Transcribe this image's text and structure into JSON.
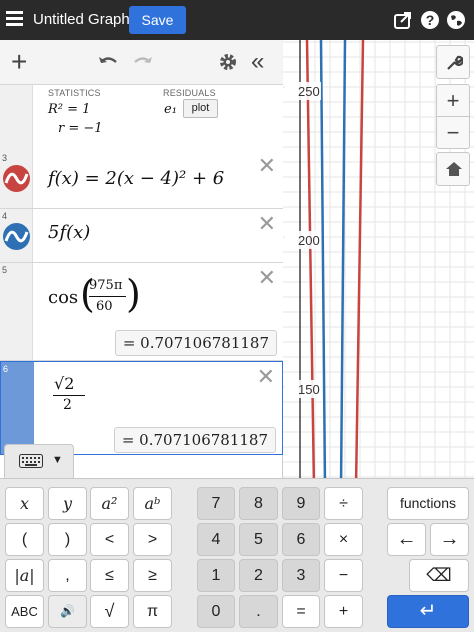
{
  "header": {
    "title": "Untitled Graph",
    "save_label": "Save"
  },
  "regression": {
    "statistics_label": "STATISTICS",
    "residuals_label": "RESIDUALS",
    "r2_text": "R² = 1",
    "r_text": "r = −1",
    "residual_var": "e₁",
    "plot_label": "plot"
  },
  "expressions": [
    {
      "number": "3",
      "latex_text": "f(x) = 2(x − 4)² + 6",
      "color": "#c74440"
    },
    {
      "number": "4",
      "latex_text": "5f(x)",
      "color": "#2d70b3"
    },
    {
      "number": "5",
      "func": "cos",
      "numerator": "975π",
      "denominator": "60",
      "result": "= 0.707106781187"
    },
    {
      "number": "6",
      "numerator": "√2",
      "denominator": "2",
      "result": "= 0.707106781187"
    }
  ],
  "graph": {
    "y_ticks": [
      "250",
      "200",
      "150"
    ],
    "colors": {
      "red": "#c74440",
      "blue": "#2d70b3",
      "grid": "#e6e6e6",
      "axis": "#333333"
    }
  },
  "keypad": {
    "row1": [
      "x",
      "y",
      "a²",
      "aᵇ",
      "7",
      "8",
      "9",
      "÷",
      "functions"
    ],
    "row2": [
      "(",
      ")",
      "<",
      ">",
      "4",
      "5",
      "6",
      "×",
      "←",
      "→"
    ],
    "row3": [
      "|a|",
      ",",
      "≤",
      "≥",
      "1",
      "2",
      "3",
      "−",
      "⌫"
    ],
    "row4": [
      "ABC",
      "🔊",
      "√",
      "π",
      "0",
      ".",
      "=",
      "+",
      "↵"
    ]
  },
  "accent_color": "#2f72dc"
}
